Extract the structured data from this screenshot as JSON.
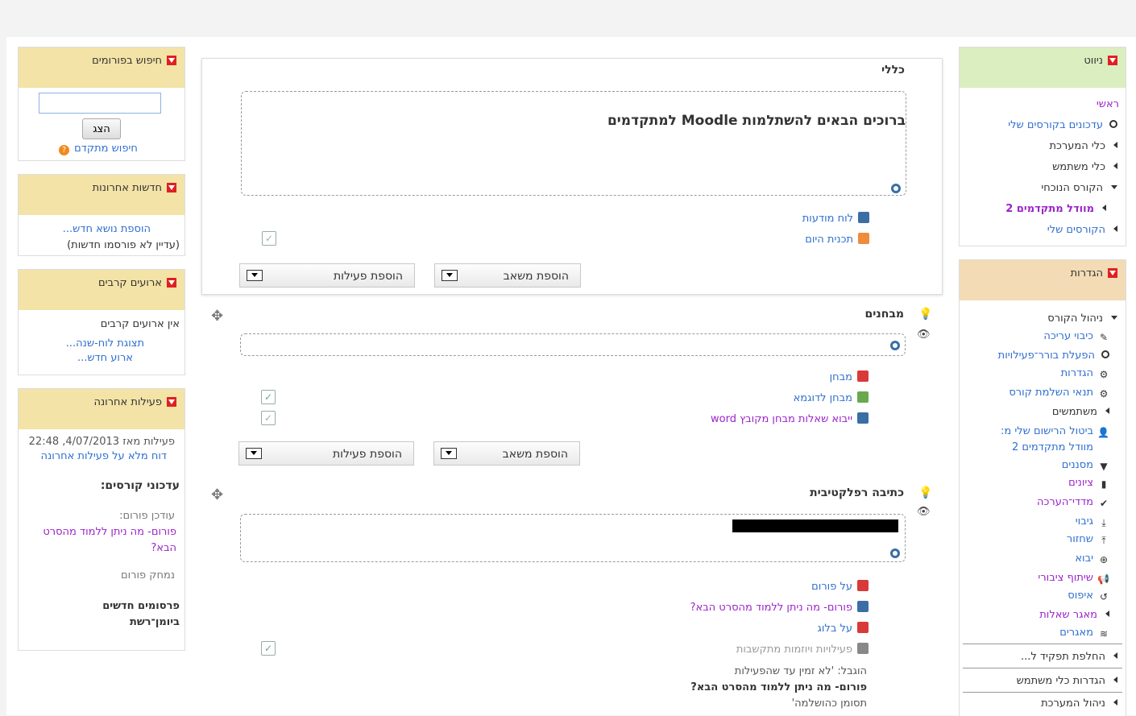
{
  "left_column": {
    "forum_search": {
      "title": "חיפוש בפורומים",
      "input_value": "",
      "button": "הצג",
      "advanced": "חיפוש מתקדם"
    },
    "latest_news": {
      "title": "חדשות אחרונות",
      "add_topic": "הוספת נושא חדש...",
      "empty": "(עדיין לא פורסמו חדשות)"
    },
    "upcoming_events": {
      "title": "ארועים קרבים",
      "empty": "אין ארועים קרבים",
      "calendar_link": "תצוגת לוח-שנה...",
      "new_event": "ארוע חדש..."
    },
    "recent_activity": {
      "title": "פעילות אחרונה",
      "since": "פעילות מאז 4/07/2013, 22:48",
      "full_report": "דוח מלא על פעילות אחרונה",
      "course_updates": "עדכוני קורסים:",
      "forum_updated": "עודכן פורום:",
      "forum_link": "פורום- מה ניתן ללמוד מהסרט הבא?",
      "forum_deleted": "נמחק פורום",
      "new_posts": "פרסומים חדשים ביומן־רשת"
    }
  },
  "right_column": {
    "navigation": {
      "title": "ניווט",
      "items": [
        {
          "label": "ראשי"
        },
        {
          "label": "עדכונים בקורסים שלי"
        },
        {
          "label": "כלי המערכת"
        },
        {
          "label": "כלי משתמש"
        },
        {
          "label": "הקורס הנוכחי"
        },
        {
          "label": "מוודל מתקדמים 2"
        },
        {
          "label": "הקורסים שלי"
        }
      ]
    },
    "settings": {
      "title": "הגדרות",
      "items": [
        {
          "label": "ניהול הקורס"
        },
        {
          "label": "כיבוי עריכה"
        },
        {
          "label": "הפעלת בורר־פעילויות"
        },
        {
          "label": "הגדרות"
        },
        {
          "label": "תנאי השלמת קורס"
        },
        {
          "label": "משתמשים"
        },
        {
          "label": "ביטול הרישום שלי מ:"
        },
        {
          "label": "מוודל מתקדמים 2"
        },
        {
          "label": "מסננים"
        },
        {
          "label": "ציונים"
        },
        {
          "label": "מדדי־הערכה"
        },
        {
          "label": "גיבוי"
        },
        {
          "label": "שחזור"
        },
        {
          "label": "יבוא"
        },
        {
          "label": "שיתוף ציבורי"
        },
        {
          "label": "איפוס"
        },
        {
          "label": "מאגר שאלות"
        },
        {
          "label": "מאגרים"
        },
        {
          "label": "החלפת תפקיד ל..."
        },
        {
          "label": "הגדרות כלי משתמש"
        },
        {
          "label": "ניהול המערכת"
        }
      ]
    }
  },
  "main": {
    "general": {
      "title": "כללי",
      "welcome": "ברוכים הבאים להשתלמות Moodle למתקדמים",
      "activities": [
        {
          "label": "לוח מודעות"
        },
        {
          "label": "תכנית היום"
        }
      ],
      "add_resource": "הוספת משאב",
      "add_activity": "הוספת פעילות"
    },
    "quizzes": {
      "title": "מבחנים",
      "activities": [
        {
          "label": "מבחן"
        },
        {
          "label": "מבחן לדוגמא"
        },
        {
          "label": "ייבוא שאלות מבחן מקובץ word"
        }
      ],
      "add_resource": "הוספת משאב",
      "add_activity": "הוספת פעילות"
    },
    "reflective": {
      "title": "כתיבה רפלקטיבית",
      "activities": [
        {
          "label": "על פורום"
        },
        {
          "label": "פורום- מה ניתן ללמוד מהסרט הבא?"
        },
        {
          "label": "על בלוג"
        },
        {
          "label": "פעילויות ויוזמות מתקשבות"
        }
      ],
      "restricted_label": "הוגבל: 'לא זמין עד שהפעילות",
      "restricted_name": "פורום- מה ניתן ללמוד מהסרט הבא?",
      "restricted_tail": "תסומן כהושלמה'"
    }
  },
  "colors": {
    "link": "#2f6fcf",
    "purple": "#9b23c9",
    "block_yellow": "#f3e3a6",
    "block_green": "#dbeec0",
    "block_tan": "#f2dbb5"
  }
}
